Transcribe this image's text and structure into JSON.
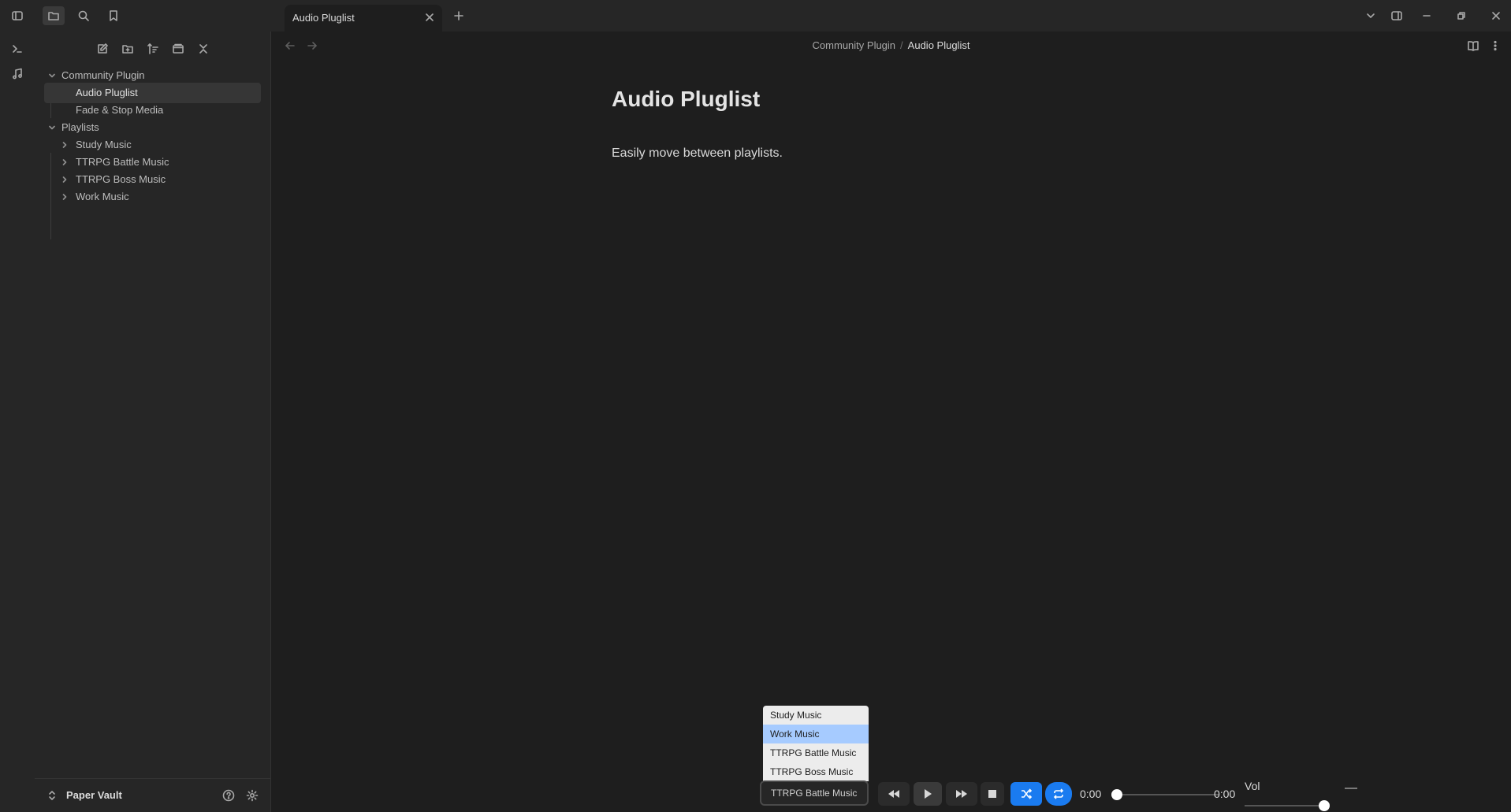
{
  "tab": {
    "title": "Audio Pluglist"
  },
  "sidebar": {
    "tree": [
      {
        "label": "Community Plugin",
        "type": "folder",
        "expanded": true
      },
      {
        "label": "Audio Pluglist",
        "type": "file",
        "selected": true
      },
      {
        "label": "Fade & Stop Media",
        "type": "file"
      },
      {
        "label": "Playlists",
        "type": "folder",
        "expanded": true
      },
      {
        "label": "Study Music",
        "type": "folder",
        "expanded": false
      },
      {
        "label": "TTRPG Battle Music",
        "type": "folder",
        "expanded": false
      },
      {
        "label": "TTRPG Boss Music",
        "type": "folder",
        "expanded": false
      },
      {
        "label": "Work Music",
        "type": "folder",
        "expanded": false
      }
    ],
    "vault_name": "Paper Vault"
  },
  "breadcrumb": {
    "parent": "Community Plugin",
    "separator": "/",
    "current": "Audio Pluglist"
  },
  "document": {
    "title": "Audio Pluglist",
    "body": "Easily move between playlists."
  },
  "player": {
    "playlist_options": [
      "Study Music",
      "Work Music",
      "TTRPG Battle Music",
      "TTRPG Boss Music"
    ],
    "highlighted_option": "Work Music",
    "selected_playlist": "TTRPG Battle Music",
    "current_time": "0:00",
    "duration": "0:00",
    "progress": 0,
    "volume_label": "Vol",
    "volume": 1.0,
    "minimize_label": "—",
    "shuffle_on": true,
    "repeat_on": true
  },
  "colors": {
    "accent": "#1a7bf0",
    "highlight": "#a6cbff",
    "background": "#1e1e1e",
    "panel": "#262626"
  }
}
